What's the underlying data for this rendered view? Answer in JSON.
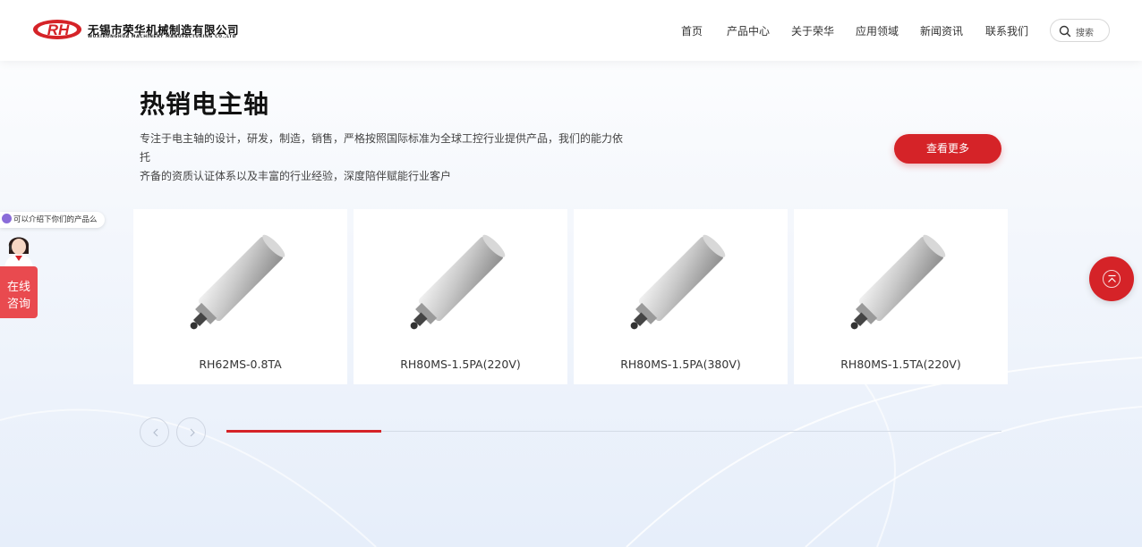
{
  "brand": {
    "logo_text": "RH",
    "company_cn": "无锡市荣华机械制造有限公司",
    "company_en": "WUXIRONGHUA MACHINERY MANUFACTURING CO.,LTD"
  },
  "nav": {
    "items": [
      {
        "label": "首页"
      },
      {
        "label": "产品中心"
      },
      {
        "label": "关于荣华"
      },
      {
        "label": "应用领域"
      },
      {
        "label": "新闻资讯"
      },
      {
        "label": "联系我们"
      }
    ],
    "search_label": "搜索"
  },
  "section": {
    "title": "热销电主轴",
    "desc_line1": "专注于电主轴的设计，研发，制造，销售，严格按照国际标准为全球工控行业提供产品，我们的能力依托",
    "desc_line2": "齐备的资质认证体系以及丰富的行业经验，深度陪伴赋能行业客户",
    "more_label": "查看更多"
  },
  "products": [
    {
      "name": "RH62MS-0.8TA"
    },
    {
      "name": "RH80MS-1.5PA(220V)"
    },
    {
      "name": "RH80MS-1.5PA(380V)"
    },
    {
      "name": "RH80MS-1.5TA(220V)"
    }
  ],
  "slider": {
    "progress_fraction": 0.2
  },
  "chat": {
    "bubble_text": "可以介绍下你们的产品么",
    "tab_line1": "在线",
    "tab_line2": "咨询"
  },
  "colors": {
    "accent": "#d52328",
    "chat_tab": "#e94a4f"
  },
  "icons": {
    "search": "search-icon",
    "prev": "chevron-left-icon",
    "next": "chevron-right-icon",
    "back_to_top": "arrow-up-icon"
  }
}
